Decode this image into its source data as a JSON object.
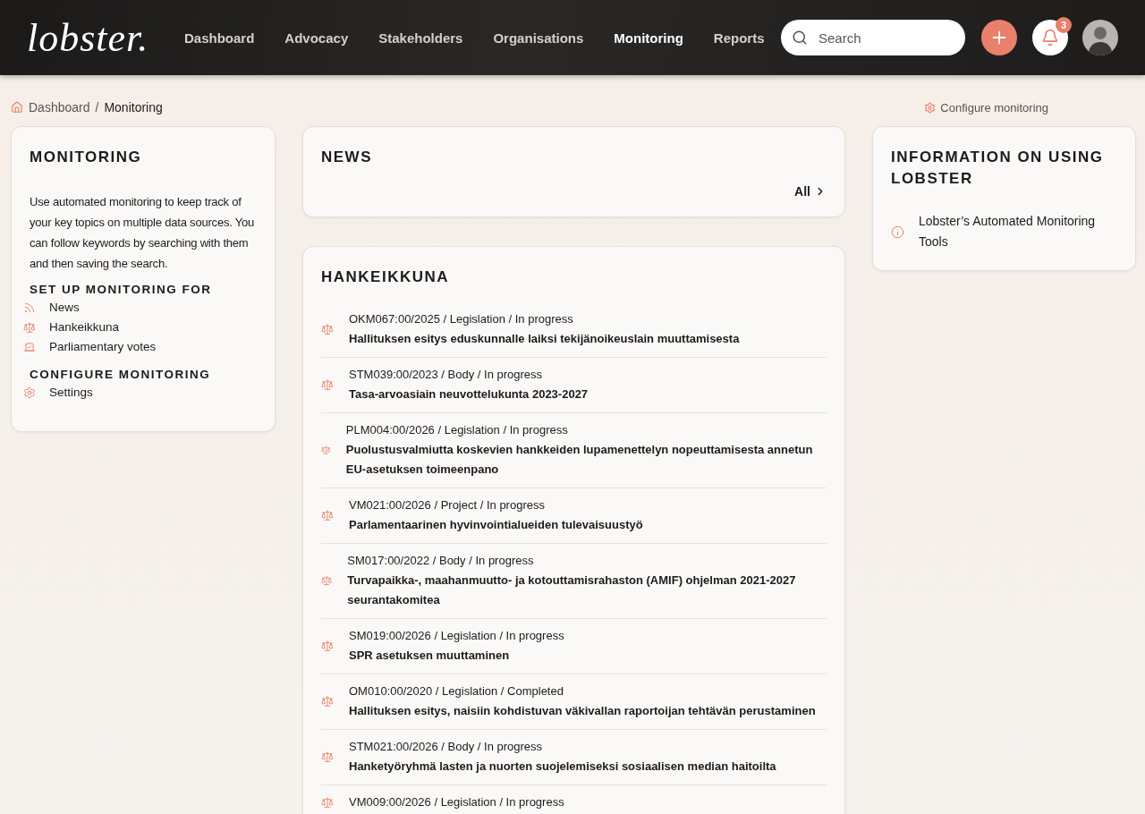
{
  "header": {
    "logo": "lobster.",
    "nav": [
      {
        "label": "Dashboard",
        "selected": false
      },
      {
        "label": "Advocacy",
        "selected": false
      },
      {
        "label": "Stakeholders",
        "selected": false
      },
      {
        "label": "Organisations",
        "selected": false
      },
      {
        "label": "Monitoring",
        "selected": true
      },
      {
        "label": "Reports",
        "selected": false
      }
    ],
    "search": {
      "placeholder": "Search"
    },
    "notifications": {
      "count": "3"
    }
  },
  "breadcrumb": {
    "items": [
      "Dashboard",
      "Monitoring"
    ],
    "separator": "/"
  },
  "configure_link": "Configure monitoring",
  "monitoring_card": {
    "title": "MONITORING",
    "description": "Use automated monitoring to keep track of your key topics on multiple data sources. You can follow keywords by searching with them and then saving the search.",
    "sections": [
      {
        "heading": "SET UP MONITORING FOR",
        "items": [
          {
            "label": "News",
            "kind": "rss"
          },
          {
            "label": "Hankeikkuna",
            "kind": "scale"
          },
          {
            "label": "Parliamentary votes",
            "kind": "vote"
          }
        ]
      },
      {
        "heading": "CONFIGURE MONITORING",
        "items": [
          {
            "label": "Settings",
            "kind": "gear"
          }
        ]
      }
    ]
  },
  "news_card": {
    "title": "NEWS",
    "all_link": "All"
  },
  "hankeikkuna_card": {
    "title": "HANKEIKKUNA",
    "items": [
      {
        "meta": "OKM067:00/2025 / Legislation / In progress",
        "title": "Hallituksen esitys eduskunnalle laiksi tekijänoikeuslain muuttamisesta"
      },
      {
        "meta": "STM039:00/2023 / Body / In progress",
        "title": "Tasa-arvoasiain neuvottelukunta 2023-2027"
      },
      {
        "meta": "PLM004:00/2026 / Legislation / In progress",
        "title": "Puolustusvalmiutta koskevien hankkeiden lupamenettelyn nopeuttamisesta annetun EU-asetuksen toimeenpano"
      },
      {
        "meta": "VM021:00/2026 / Project / In progress",
        "title": "Parlamentaarinen hyvinvointialueiden tulevaisuustyö"
      },
      {
        "meta": "SM017:00/2022 / Body / In progress",
        "title": "Turvapaikka-, maahanmuutto- ja kotouttamisrahaston (AMIF) ohjelman 2021-2027 seurantakomitea"
      },
      {
        "meta": "SM019:00/2026 / Legislation / In progress",
        "title": "SPR asetuksen muuttaminen"
      },
      {
        "meta": "OM010:00/2020 / Legislation / Completed",
        "title": "Hallituksen esitys, naisiin kohdistuvan väkivallan raportoijan tehtävän perustaminen"
      },
      {
        "meta": "STM021:00/2026 / Body / In progress",
        "title": "Hanketyöryhmä lasten ja nuorten suojelemiseksi sosiaalisen median haitoilta"
      },
      {
        "meta": "VM009:00/2026 / Legislation / In progress"
      }
    ]
  },
  "info_card": {
    "title": "INFORMATION ON USING LOBSTER",
    "links": [
      {
        "label": "Lobster’s Automated Monitoring Tools"
      }
    ]
  }
}
